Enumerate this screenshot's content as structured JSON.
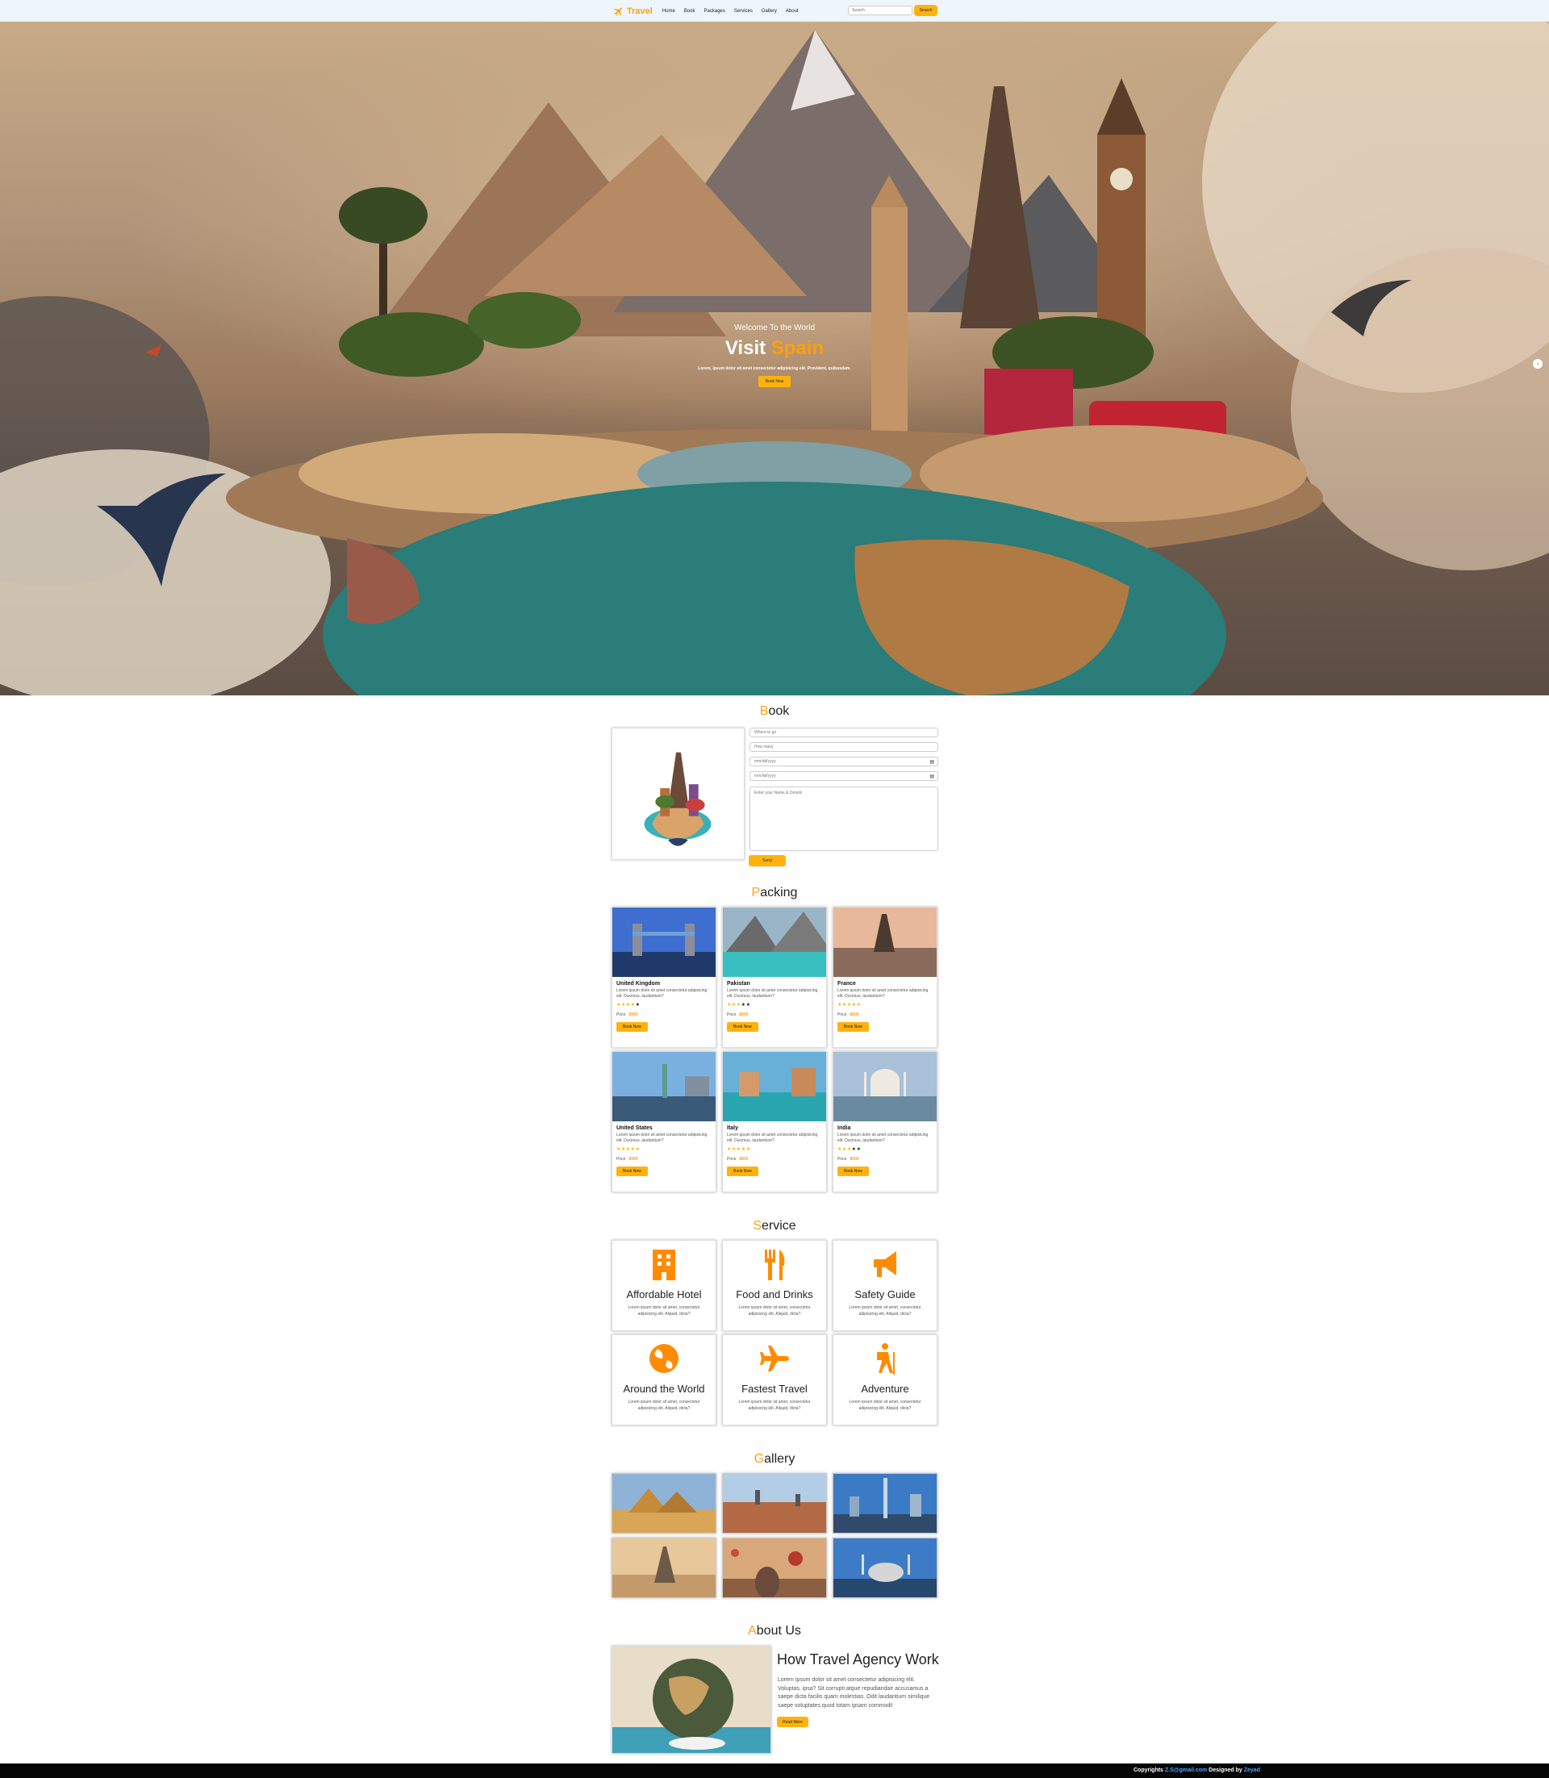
{
  "nav": {
    "logo_text": "Travel",
    "links": [
      "Home",
      "Book",
      "Packages",
      "Services",
      "Gallery",
      "About"
    ],
    "search_placeholder": "Search",
    "search_button": "Search",
    "accent_color": "#ffb20e"
  },
  "hero": {
    "subtitle": "Welcome To the World",
    "title_main": "Visit",
    "title_accent": "Spain",
    "description": "Lorem, ipsum dolor sit amet consectetur adipisicing elit. Provident, quibusdam.",
    "button": "Book Now",
    "next_arrow": "›"
  },
  "book": {
    "title_first": "B",
    "title_rest": "ook",
    "fields": {
      "where": "Where to go",
      "guests": "How many",
      "arrival": "mm/dd/yyyy",
      "leaving": "mm/dd/yyyy",
      "details": "Enter your Name & Details"
    },
    "send_button": "Send"
  },
  "packages": {
    "title_first": "P",
    "title_rest": "acking",
    "price_label": "Price",
    "book_button": "Book Now",
    "description": "Lorem ipsum dolor sit amet consectetur adipisicing elit. Ducimus, laudantium?",
    "items": [
      {
        "name": "United Kingdom",
        "rating": 4,
        "price": "$900"
      },
      {
        "name": "Pakistan",
        "rating": 3,
        "price": "$600"
      },
      {
        "name": "France",
        "rating": 5,
        "price": "$800"
      },
      {
        "name": "United States",
        "rating": 5,
        "price": "$900"
      },
      {
        "name": "Italy",
        "rating": 5,
        "price": "$800"
      },
      {
        "name": "India",
        "rating": 3,
        "price": "$500"
      }
    ]
  },
  "services": {
    "title_first": "S",
    "title_rest": "ervice",
    "description": "Lorem ipsum dolor sit amet, consectetur adipisicing elit. Aliquid, dicta?",
    "items": [
      {
        "title": "Affordable Hotel",
        "icon": "hotel-icon"
      },
      {
        "title": "Food and Drinks",
        "icon": "utensils-icon"
      },
      {
        "title": "Safety Guide",
        "icon": "megaphone-icon"
      },
      {
        "title": "Around the World",
        "icon": "globe-icon"
      },
      {
        "title": "Fastest Travel",
        "icon": "plane-icon"
      },
      {
        "title": "Adventure",
        "icon": "hiking-icon"
      }
    ]
  },
  "gallery": {
    "title_first": "G",
    "title_rest": "allery"
  },
  "about": {
    "title_first": "A",
    "title_rest": "bout Us",
    "heading": "How Travel Agency Work",
    "text": "Lorem ipsum dolor sit amet consectetur adipisicing elit. Voluptas, ipsa? Sit corrupti atque repudiandae accusamus a saepe dicta facilis quam molestias. Odit laudantium similique saepe voluptates quod totam ipsam commodi!",
    "button": "Read More"
  },
  "footer": {
    "prefix": "Copyrights ",
    "email": "Z.S@gmail.com",
    "middle": " Designed by ",
    "author": "Zeyad"
  }
}
